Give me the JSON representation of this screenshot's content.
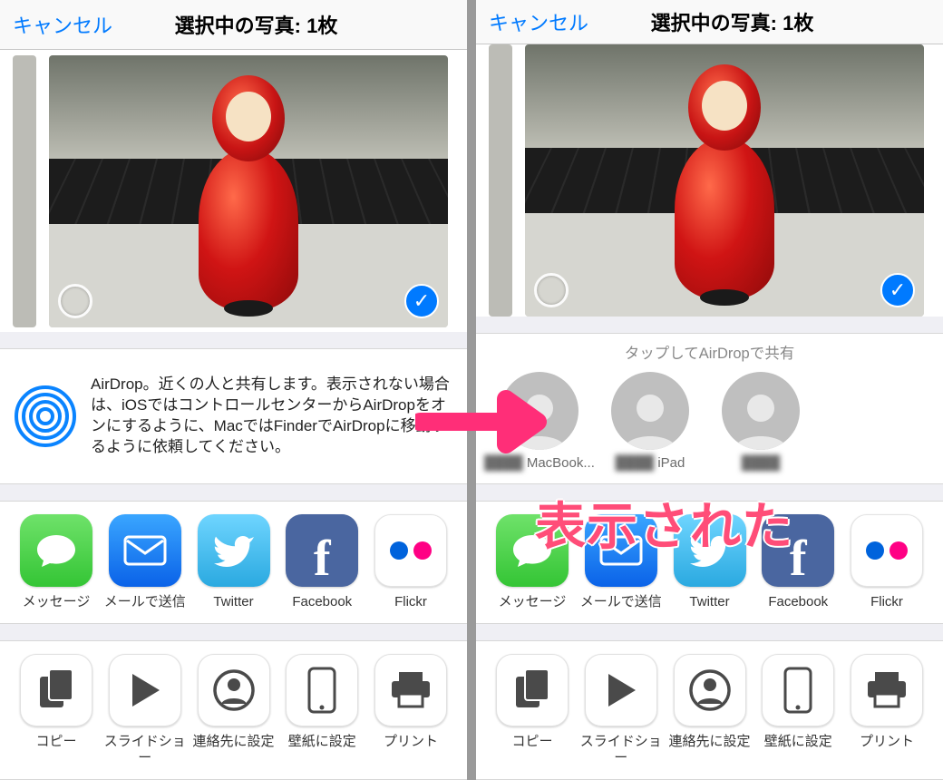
{
  "nav": {
    "cancel": "キャンセル",
    "title": "選択中の写真: 1枚"
  },
  "airdrop": {
    "description": "AirDrop。近くの人と共有します。表示されない場合は、iOSではコントロールセンターからAirDropをオンにするように、MacではFinderでAirDropに移動するように依頼してください。",
    "tap_hint": "タップしてAirDropで共有",
    "contacts": [
      {
        "label": "MacBook..."
      },
      {
        "label": "iPad"
      },
      {
        "label": ""
      }
    ]
  },
  "apps": [
    {
      "name": "messages",
      "label": "メッセージ"
    },
    {
      "name": "mail",
      "label": "メールで送信"
    },
    {
      "name": "twitter",
      "label": "Twitter"
    },
    {
      "name": "facebook",
      "label": "Facebook"
    },
    {
      "name": "flickr",
      "label": "Flickr"
    }
  ],
  "actions": [
    {
      "name": "copy",
      "label": "コピー"
    },
    {
      "name": "slideshow",
      "label": "スライドショー"
    },
    {
      "name": "assign-contact",
      "label": "連絡先に設定"
    },
    {
      "name": "set-wallpaper",
      "label": "壁紙に設定"
    },
    {
      "name": "print",
      "label": "プリント"
    }
  ],
  "annotation": {
    "callout": "表示された"
  }
}
